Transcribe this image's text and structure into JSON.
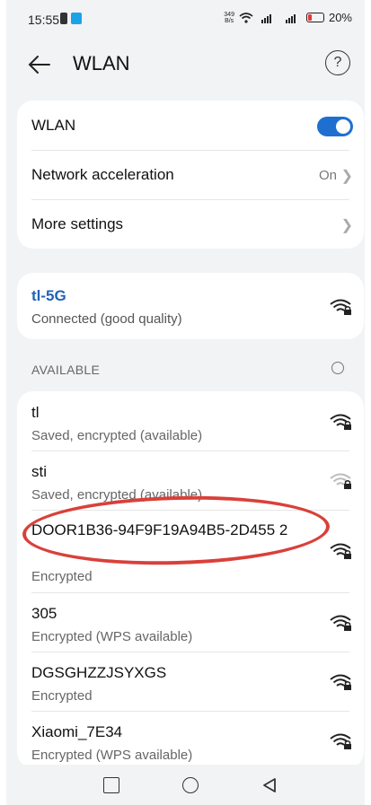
{
  "status_bar": {
    "time": "15:55",
    "speed_value": "349",
    "speed_unit": "B/s",
    "battery": "20%"
  },
  "header": {
    "title": "WLAN",
    "help_icon": "?"
  },
  "settings": {
    "wlan_label": "WLAN",
    "wlan_enabled": true,
    "acceleration_label": "Network acceleration",
    "acceleration_value": "On",
    "more_label": "More settings"
  },
  "connected": {
    "name": "tl-5G",
    "status": "Connected (good quality)"
  },
  "available_label": "AVAILABLE",
  "networks": [
    {
      "name": "tl",
      "status": "Saved, encrypted (available)",
      "signal": "strong"
    },
    {
      "name": "sti",
      "status": "Saved, encrypted (available)",
      "signal": "weak"
    },
    {
      "name": "DOOR1B36-94F9F19A94B5-2D455 2",
      "status": "Encrypted",
      "signal": "strong"
    },
    {
      "name": "305",
      "status": "Encrypted (WPS available)",
      "signal": "strong"
    },
    {
      "name": "DGSGHZZJSYXGS",
      "status": "Encrypted",
      "signal": "strong"
    },
    {
      "name": "Xiaomi_7E34",
      "status": "Encrypted (WPS available)",
      "signal": "strong"
    }
  ],
  "colors": {
    "accent": "#1f6fd1",
    "link": "#1f63b8",
    "highlight_ring": "#d9403a",
    "background": "#f1f3f5"
  }
}
